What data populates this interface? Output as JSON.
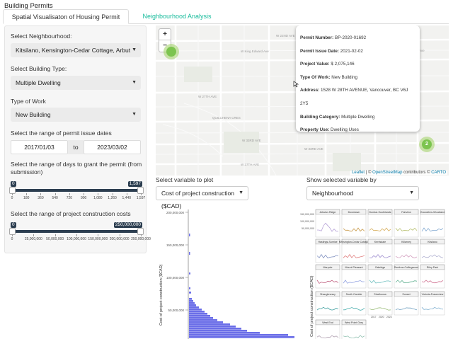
{
  "app": {
    "title": "Building Permits"
  },
  "tabs": [
    {
      "label": "Spatial Visualisaton of Housing Permit"
    },
    {
      "label": "Neighbourhood Analysis"
    }
  ],
  "sidebar": {
    "neighbourhood_label": "Select Neighbourhood:",
    "neighbourhood_value": "Kitsilano, Kensington-Cedar Cottage, Arbut",
    "building_type_label": "Select Building Type:",
    "building_type_value": "Multiple Dwelling",
    "work_type_label": "Type of Work",
    "work_type_value": "New Building",
    "date_label": "Select the range of permit issue dates",
    "date_start": "2017/01/03",
    "date_sep": "to",
    "date_end": "2023/03/02",
    "days_label": "Select the range of days to grant the permit (from submission)",
    "days_min_badge": "0",
    "days_max_badge": "1,597",
    "days_min": 0,
    "days_max": 1597,
    "days_ticks": [
      "0",
      "180",
      "360",
      "540",
      "720",
      "900",
      "1,080",
      "1,260",
      "1,440",
      "1,597"
    ],
    "cost_label": "Select the range of project construction costs",
    "cost_min_badge": "0",
    "cost_max_badge": "250,000,000",
    "cost_min": 0,
    "cost_max": 250000000,
    "cost_ticks": [
      "0",
      "25,000,000",
      "50,000,000",
      "100,000,000",
      "150,000,000",
      "200,000,000",
      "250,000,000"
    ]
  },
  "map": {
    "zoom_in": "+",
    "zoom_out": "−",
    "clusters": [
      {
        "count": "2"
      },
      {
        "count": "2"
      }
    ],
    "popup": {
      "rows": [
        {
          "key": "Permit Number:",
          "value": " BP-2020-01692"
        },
        {
          "key": "Permit Issue Date:",
          "value": " 2021-02-02"
        },
        {
          "key": "Project Value:",
          "value": " $ 2,075,146"
        },
        {
          "key": "Type Of Work:",
          "value": " New Building"
        },
        {
          "key": "Address:",
          "value": " 1528 W 28TH AVENUE, Vancouver, BC V6J 2Y5"
        },
        {
          "key": "Building Category:",
          "value": " Multiple Dwelling"
        },
        {
          "key": "Property Use:",
          "value": " Dwelling Uses"
        }
      ]
    },
    "street_labels": [
      "W 22ND AVE",
      "W King Edward Ave",
      "W King Edward Ave",
      "W 27TH AVE",
      "QUILCHENA CRES",
      "W 33RD AVE",
      "W 37TH AVE",
      "W 33RD AVE"
    ],
    "attribution": {
      "leaflet": "Leaflet",
      "sep1": " | © ",
      "osm": "OpenStreetMap",
      "mid": " contributors © ",
      "carto": "CARTO"
    }
  },
  "controls": {
    "variable_label": "Select variable to plot",
    "variable_value": "Cost of project construction ($CAD)",
    "group_label": "Show selected variable by",
    "group_value": "Neighbourhood"
  },
  "chart_data": [
    {
      "type": "bar",
      "ylabel": "Cost of project construction ($CAD)",
      "tick_labels": [
        "200,000,000",
        "150,000,000",
        "100,000,000",
        "50,000,000"
      ],
      "color": "#6b6ee8"
    },
    {
      "type": "line",
      "ylabel": "Cost of project construction ($CAD)",
      "panels": [
        "Arbutus Ridge",
        "Downtown",
        "Dunbar-Southlands",
        "Fairview",
        "Grandview-Woodland",
        "Hastings-Sunrise",
        "Kensington-Cedar Cottage",
        "Kerrisdale",
        "Killarney",
        "Kitsilano",
        "Marpole",
        "Mount Pleasant",
        "Oakridge",
        "Renfrew-Collingwood",
        "Riley Park",
        "Shaughnessy",
        "South Cambie",
        "Strathcona",
        "Sunset",
        "Victoria-Fraserview",
        "West End",
        "West Point Grey"
      ],
      "y_ticks": [
        "150,000,000",
        "100,000,000",
        "50,000,000",
        "0"
      ],
      "x_ticks": [
        "2017",
        "2020",
        "2023"
      ]
    }
  ]
}
